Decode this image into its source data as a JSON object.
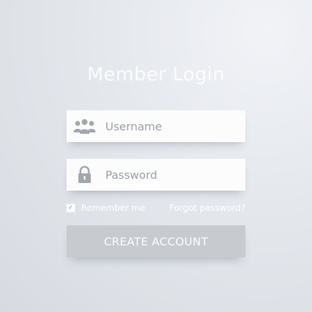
{
  "login": {
    "title": "Member Login",
    "username_placeholder": "Username",
    "password_placeholder": "Password",
    "remember_label": "Remember me",
    "remember_checked": true,
    "forgot_label": "Forgot password?",
    "submit_label": "CREATE ACCOUNT"
  },
  "icons": {
    "username": "users-icon",
    "password": "lock-icon",
    "checkbox": "checkmark-icon"
  },
  "colors": {
    "background": "#dde0e5",
    "field_background": "#fcfcfd",
    "placeholder": "#9a9fa7",
    "icon": "#a3a7ad",
    "button_background": "#c7cbd0",
    "title_text": "#fbfcfd"
  }
}
